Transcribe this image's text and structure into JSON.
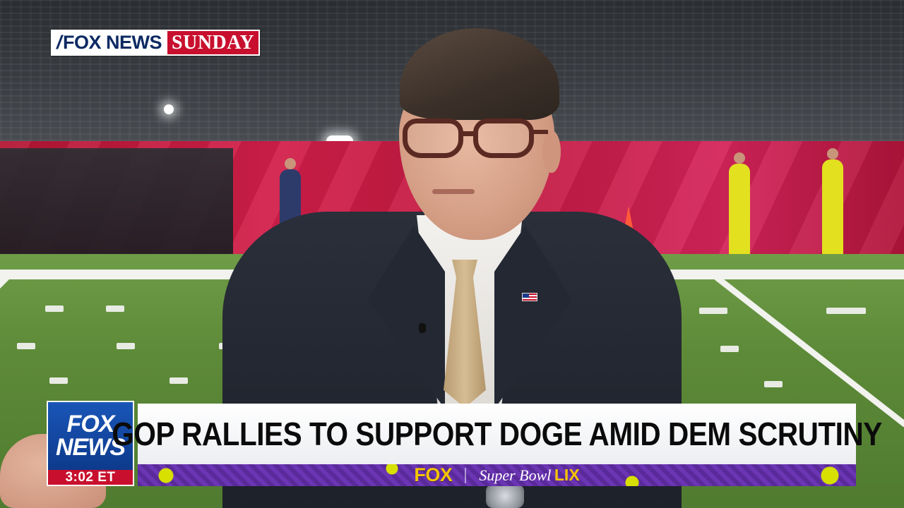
{
  "show_logo": {
    "brand": "FOX NEWS",
    "day": "SUNDAY"
  },
  "lower_third": {
    "network_top": "FOX",
    "network_bottom": "NEWS",
    "time": "3:02 ET",
    "headline": "GOP RALLIES TO SUPPORT DOGE AMID DEM SCRUTINY",
    "ticker": {
      "brand": "FOX",
      "event": "Super Bowl",
      "event_number": "LIX"
    }
  },
  "colors": {
    "fox_blue": "#0d3a8c",
    "fox_red": "#c8102e",
    "ticker_purple": "#5a2a9a",
    "ticker_yellow": "#f5c400"
  }
}
